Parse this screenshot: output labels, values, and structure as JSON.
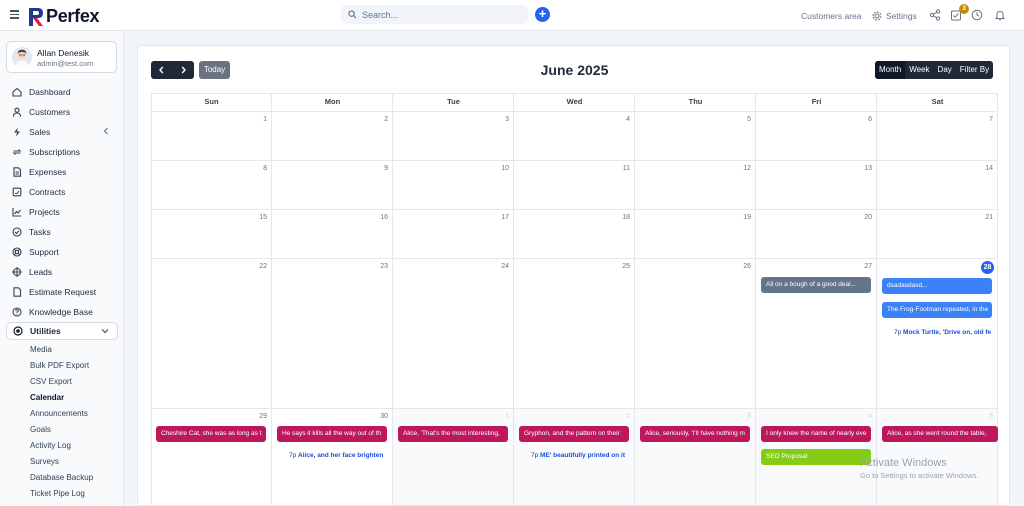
{
  "header": {
    "brand": "Perfex",
    "search_placeholder": "Search...",
    "customers_area": "Customers area",
    "settings": "Settings",
    "notification_count": "3",
    "brand_color": "#2563eb"
  },
  "profile": {
    "name": "Allan Denesik",
    "email": "admin@test.com"
  },
  "sidebar": {
    "items": [
      {
        "label": "Dashboard",
        "icon": "home-icon"
      },
      {
        "label": "Customers",
        "icon": "user-icon"
      },
      {
        "label": "Sales",
        "icon": "bolt-icon"
      },
      {
        "label": "Subscriptions",
        "icon": "refresh-icon"
      },
      {
        "label": "Expenses",
        "icon": "document-icon"
      },
      {
        "label": "Contracts",
        "icon": "contract-icon"
      },
      {
        "label": "Projects",
        "icon": "chart-icon"
      },
      {
        "label": "Tasks",
        "icon": "check-circle-icon"
      },
      {
        "label": "Support",
        "icon": "lifebuoy-icon"
      },
      {
        "label": "Leads",
        "icon": "target-icon"
      },
      {
        "label": "Estimate Request",
        "icon": "file-icon"
      },
      {
        "label": "Knowledge Base",
        "icon": "help-icon"
      },
      {
        "label": "Utilities",
        "icon": "utilities-icon"
      }
    ],
    "sub_items": [
      "Media",
      "Bulk PDF Export",
      "CSV Export",
      "Calendar",
      "Announcements",
      "Goals",
      "Activity Log",
      "Surveys",
      "Database Backup",
      "Ticket Pipe Log"
    ],
    "current_sub": "Calendar"
  },
  "calendar": {
    "title": "June 2025",
    "today_label": "Today",
    "views": [
      "Month",
      "Week",
      "Day",
      "Filter By"
    ],
    "selected_view": "Month",
    "weekdays": [
      "Sun",
      "Mon",
      "Tue",
      "Wed",
      "Thu",
      "Fri",
      "Sat"
    ],
    "weeks": [
      [
        "1",
        "2",
        "3",
        "4",
        "5",
        "6",
        "7"
      ],
      [
        "8",
        "9",
        "10",
        "11",
        "12",
        "13",
        "14"
      ],
      [
        "15",
        "16",
        "17",
        "18",
        "19",
        "20",
        "21"
      ],
      [
        "22",
        "23",
        "24",
        "25",
        "26",
        "27",
        "28"
      ],
      [
        "29",
        "30",
        "1",
        "2",
        "3",
        "4",
        "5"
      ]
    ],
    "today_day": "28",
    "events": [
      {
        "text": "All on a bough of a good deal...",
        "color": "slate"
      },
      {
        "text": "dsadasdasd...",
        "color": "blue"
      },
      {
        "text": "The Frog-Footman repeated, in the",
        "color": "blue"
      },
      {
        "time": "7p",
        "text": "Mock Turtle, 'Drive on, old fe"
      },
      {
        "text": "Cheshire Cat, she was as long as t",
        "color": "pink"
      },
      {
        "text": "He says it kills all the way out of th",
        "color": "pink"
      },
      {
        "time": "7p",
        "text": "Alice, and her face brighten"
      },
      {
        "text": "Alice. 'That's the most interesting,",
        "color": "pink"
      },
      {
        "text": "Gryphon, and the pattern on their",
        "color": "pink"
      },
      {
        "time": "7p",
        "text": "ME' beautifully printed on it"
      },
      {
        "text": "Alice, seriously, 'I'll have nothing m",
        "color": "pink"
      },
      {
        "text": "I only knew the name of nearly eve",
        "color": "pink"
      },
      {
        "text": "SEO Proposal",
        "color": "green"
      },
      {
        "text": "Alice, as she went round the table,",
        "color": "pink"
      }
    ]
  },
  "watermark": {
    "line1": "Activate Windows",
    "line2": "Go to Settings to activate Windows."
  }
}
